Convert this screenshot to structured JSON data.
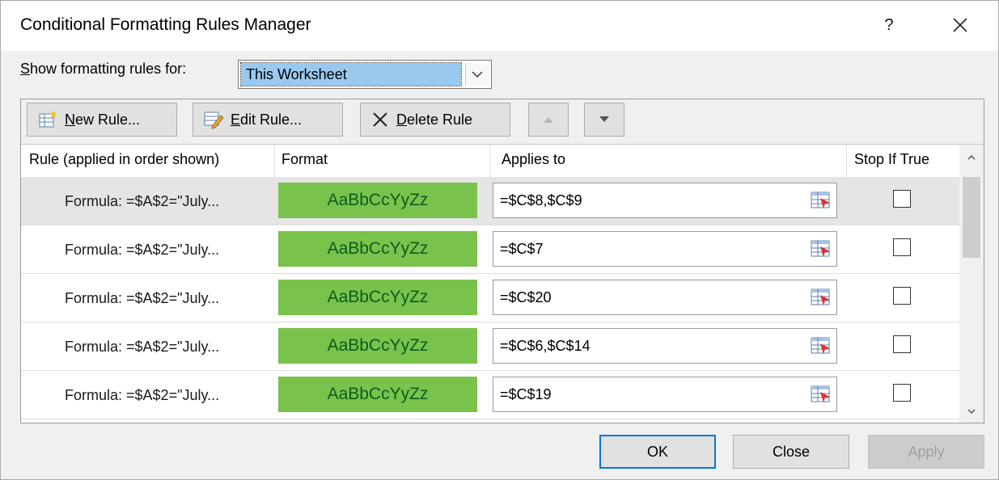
{
  "window": {
    "title": "Conditional Formatting Rules Manager",
    "help_label": "?"
  },
  "scope": {
    "label_accel": "S",
    "label_rest": "how formatting rules for:",
    "value": "This Worksheet"
  },
  "toolbar": {
    "new_rule": {
      "accel": "N",
      "rest": "ew Rule..."
    },
    "edit_rule": {
      "accel": "E",
      "rest": "dit Rule..."
    },
    "delete_rule": {
      "accel": "D",
      "rest": "elete Rule"
    }
  },
  "columns": {
    "rule": "Rule (applied in order shown)",
    "format": "Format",
    "applies_to": "Applies to",
    "stop_if_true": "Stop If True"
  },
  "rules": [
    {
      "rule": "Formula: =$A$2=\"July...",
      "preview": "AaBbCcYyZz",
      "applies_to": "=$C$8,$C$9",
      "stop_if_true": false,
      "selected": true
    },
    {
      "rule": "Formula: =$A$2=\"July...",
      "preview": "AaBbCcYyZz",
      "applies_to": "=$C$7",
      "stop_if_true": false,
      "selected": false
    },
    {
      "rule": "Formula: =$A$2=\"July...",
      "preview": "AaBbCcYyZz",
      "applies_to": "=$C$20",
      "stop_if_true": false,
      "selected": false
    },
    {
      "rule": "Formula: =$A$2=\"July...",
      "preview": "AaBbCcYyZz",
      "applies_to": "=$C$6,$C$14",
      "stop_if_true": false,
      "selected": false
    },
    {
      "rule": "Formula: =$A$2=\"July...",
      "preview": "AaBbCcYyZz",
      "applies_to": "=$C$19",
      "stop_if_true": false,
      "selected": false
    }
  ],
  "buttons": {
    "ok": "OK",
    "close": "Close",
    "apply": "Apply"
  },
  "colors": {
    "format_fill": "#79c24c",
    "format_text": "#0b5d1e",
    "selection": "#99c9ef",
    "default_button_border": "#0078d7"
  },
  "icons": {
    "new_rule": "new-rule-icon",
    "edit_rule": "edit-rule-icon",
    "delete_rule": "delete-x-icon",
    "move_up": "triangle-up-icon",
    "move_down": "triangle-down-icon",
    "range_select": "range-selector-icon"
  }
}
